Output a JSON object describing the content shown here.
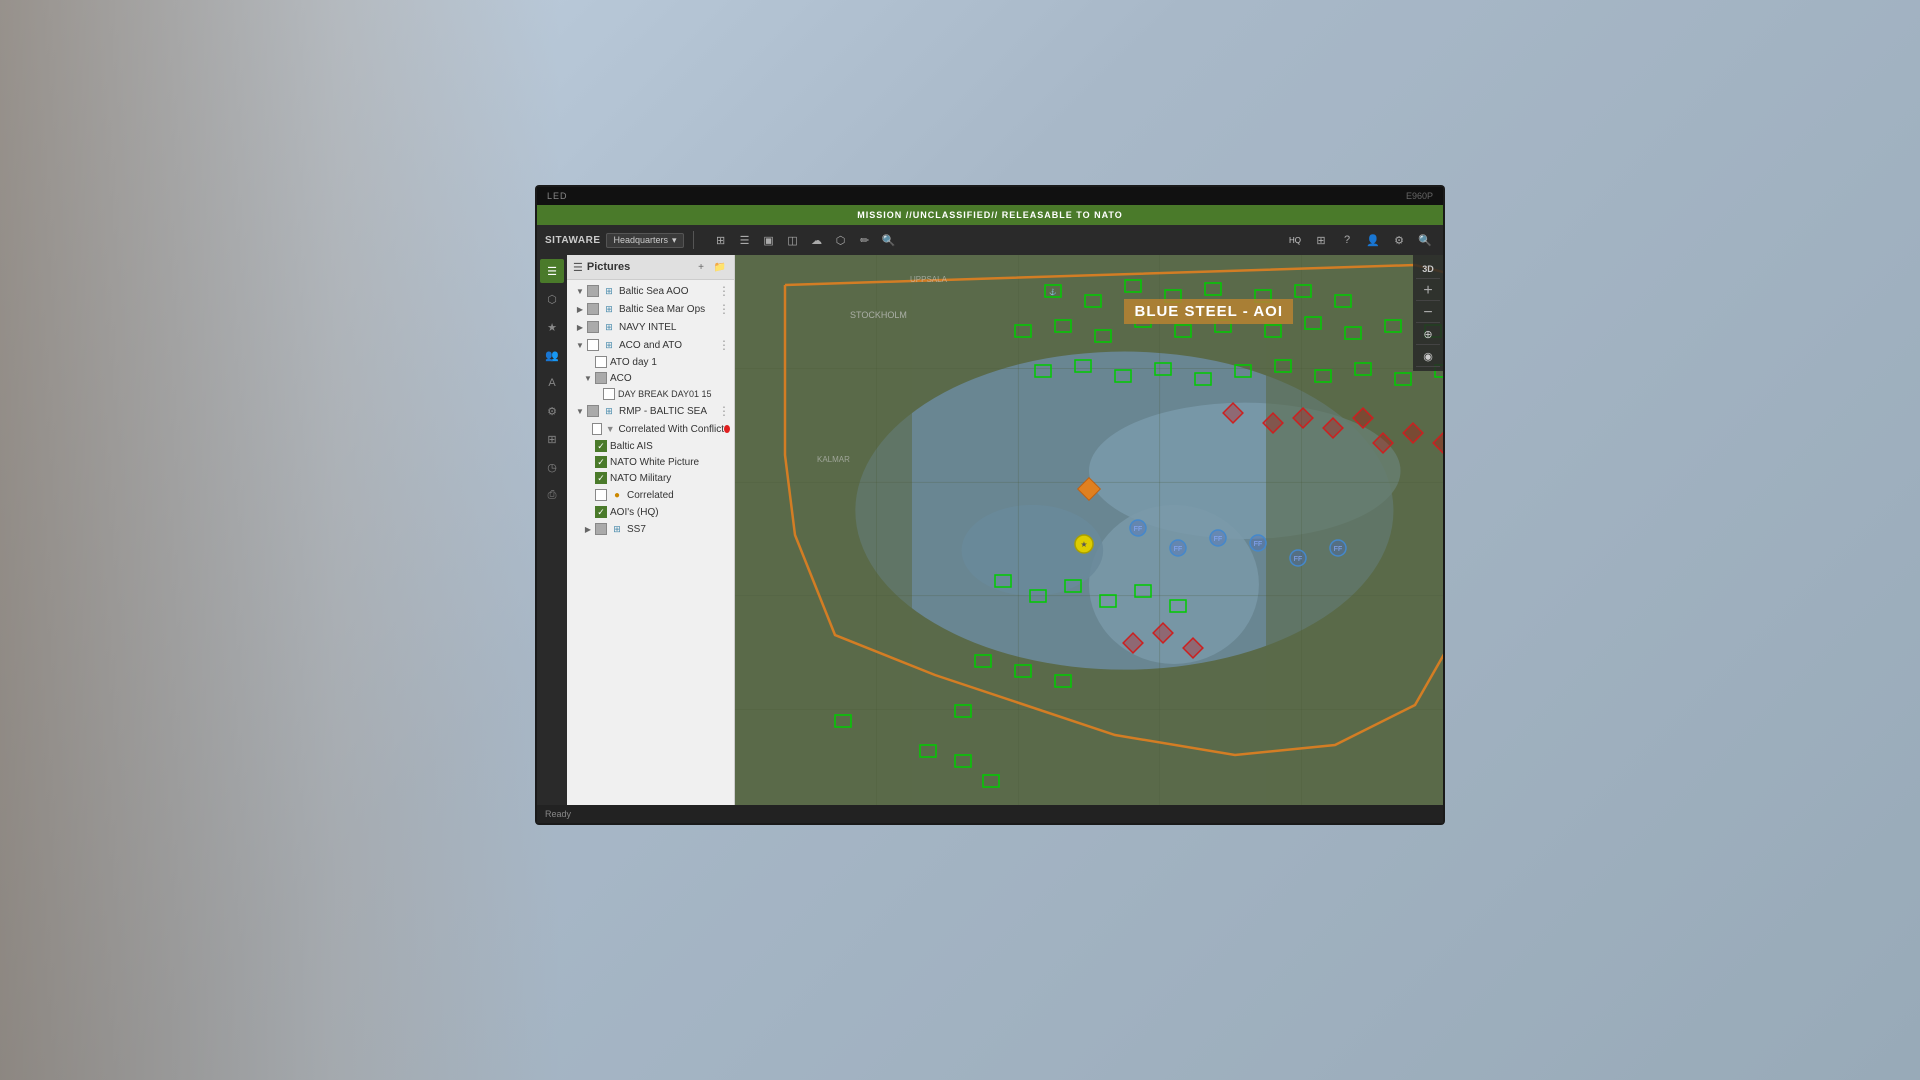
{
  "app": {
    "led_label": "LED",
    "model_label": "E960P",
    "classification": "MISSION //UNCLASSIFIED// RELEASABLE TO NATO"
  },
  "toolbar": {
    "brand": "SITAWARE",
    "dropdown_label": "Headquarters",
    "icons": [
      "⊞",
      "☰",
      "▣",
      "◫",
      "☁",
      "⬡",
      "🔍"
    ],
    "right_icons": [
      "HQ",
      "⊞",
      "?",
      "👤",
      "⚙",
      "🔍"
    ]
  },
  "left_sidebar": {
    "icons": [
      {
        "name": "layers-icon",
        "label": "☰",
        "active": true
      },
      {
        "name": "map-icon",
        "label": "⬡"
      },
      {
        "name": "star-icon",
        "label": "★"
      },
      {
        "name": "users-icon",
        "label": "👥"
      },
      {
        "name": "text-icon",
        "label": "A"
      },
      {
        "name": "tools-icon",
        "label": "⚙"
      },
      {
        "name": "grid-icon",
        "label": "⊞"
      },
      {
        "name": "clock-icon",
        "label": "🕐"
      },
      {
        "name": "print-icon",
        "label": "🖨"
      }
    ]
  },
  "layer_panel": {
    "title": "Pictures",
    "items": [
      {
        "id": "baltic-sea-aoo",
        "label": "Baltic Sea AOO",
        "level": 1,
        "expanded": true,
        "checked": "partial",
        "has_more": true
      },
      {
        "id": "baltic-sea-mar-ops",
        "label": "Baltic Sea Mar Ops",
        "level": 1,
        "expanded": false,
        "checked": "partial",
        "has_more": true
      },
      {
        "id": "navy-intel",
        "label": "NAVY INTEL",
        "level": 1,
        "expanded": false,
        "checked": "partial",
        "has_more": false
      },
      {
        "id": "aco-and-ato",
        "label": "ACO and ATO",
        "level": 1,
        "expanded": true,
        "checked": "none",
        "has_more": true
      },
      {
        "id": "ato-day1",
        "label": "ATO day 1",
        "level": 2,
        "checked": "none"
      },
      {
        "id": "aco",
        "label": "ACO",
        "level": 2,
        "expanded": true,
        "checked": "partial"
      },
      {
        "id": "day-break-day01-15",
        "label": "DAY BREAK DAY01 15",
        "level": 3,
        "checked": "none"
      },
      {
        "id": "rmp-baltic-sea",
        "label": "RMP - BALTIC SEA",
        "level": 1,
        "expanded": true,
        "checked": "none",
        "has_more": true
      },
      {
        "id": "correlated-with-conflict",
        "label": "Correlated With Conflict",
        "level": 2,
        "checked": "none",
        "dot_red": true
      },
      {
        "id": "baltic-ais",
        "label": "Baltic AIS",
        "level": 2,
        "checked": "checked"
      },
      {
        "id": "nato-white-picture",
        "label": "NATO White Picture",
        "level": 2,
        "checked": "checked"
      },
      {
        "id": "nato-military",
        "label": "NATO Military",
        "level": 2,
        "checked": "checked"
      },
      {
        "id": "correlated",
        "label": "Correlated",
        "level": 2,
        "checked": "none"
      },
      {
        "id": "aois-hq",
        "label": "AOI's (HQ)",
        "level": 2,
        "checked": "checked"
      },
      {
        "id": "ss7",
        "label": "SS7",
        "level": 2,
        "expanded": false,
        "checked": "partial"
      }
    ]
  },
  "map": {
    "aoi_label": "BLUE STEEL - AOI",
    "zoom_controls": [
      "3D",
      "⊕",
      "⊖",
      "◈",
      "◉",
      "⊞",
      "⊟"
    ]
  },
  "colors": {
    "classification_green": "#4a7a2a",
    "friendly_green": "#00aa00",
    "hostile_red": "#cc2020",
    "aoi_orange": "#e08020"
  }
}
